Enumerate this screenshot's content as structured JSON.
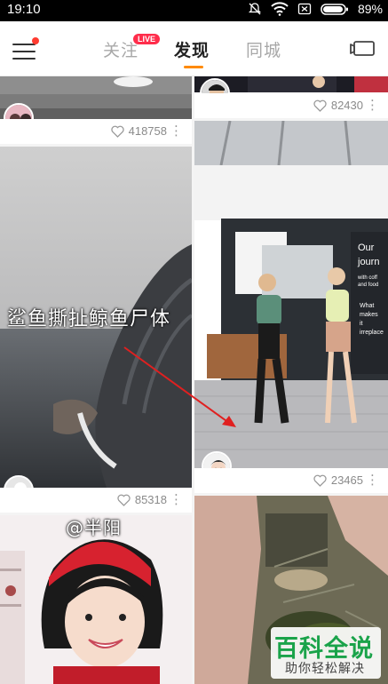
{
  "status_bar": {
    "time": "19:10",
    "battery": "89%"
  },
  "nav": {
    "tabs": [
      {
        "label": "关注",
        "active": false
      },
      {
        "label": "发现",
        "active": true
      },
      {
        "label": "同城",
        "active": false
      }
    ],
    "live_badge": "LIVE",
    "accent_color": "#ff8a00"
  },
  "feed": {
    "cards": [
      {
        "likes": "418758"
      },
      {
        "likes": "82430"
      },
      {
        "caption": "鲨鱼撕扯鲸鱼尸体",
        "likes": "85318"
      },
      {
        "likes": "23465"
      },
      {
        "caption": "@半阳"
      },
      {}
    ]
  },
  "watermark": {
    "title": "百科全说",
    "subtitle": "助你轻松解决"
  }
}
